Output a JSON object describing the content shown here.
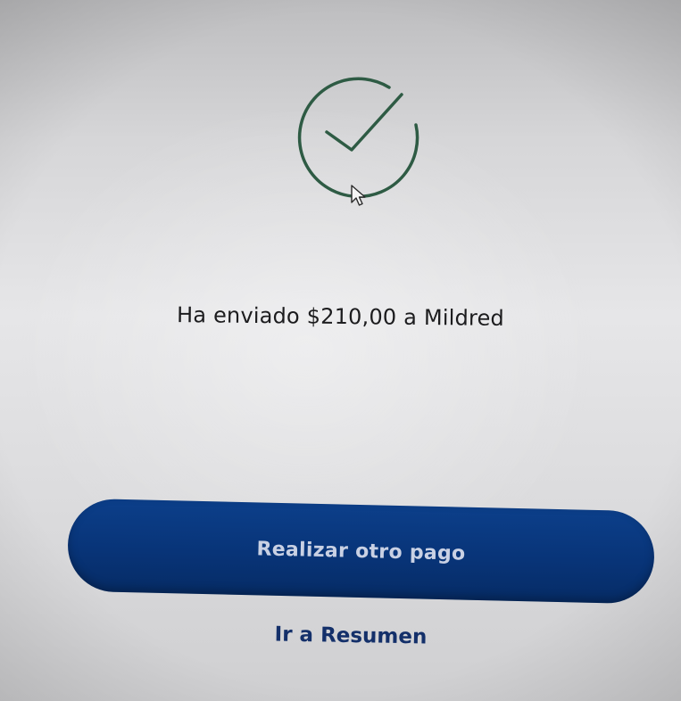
{
  "confirmation": {
    "icon": "check-circle-icon",
    "icon_color": "#2e5b44",
    "message": "Ha enviado $210,00 a Mildred"
  },
  "actions": {
    "primary_label": "Realizar otro pago",
    "primary_color": "#083478",
    "secondary_label": "Ir a Resumen",
    "secondary_color": "#14306a"
  }
}
